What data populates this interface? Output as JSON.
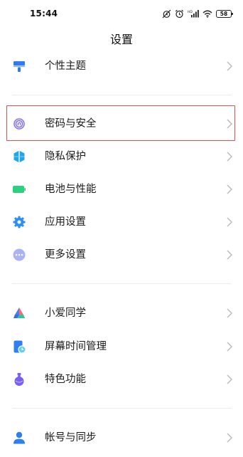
{
  "status_bar": {
    "time": "15:44",
    "battery_level": "58",
    "icons": [
      "alarm-off-icon",
      "alarm-clock-icon",
      "cellular-signal-icon",
      "wifi-icon",
      "battery-icon"
    ]
  },
  "page": {
    "title": "设置"
  },
  "groups": [
    {
      "items": [
        {
          "label": "个性主题",
          "icon": "theme-brush-icon",
          "color": "#2d7cf6"
        }
      ]
    },
    {
      "items": [
        {
          "label": "密码与安全",
          "icon": "fingerprint-icon",
          "color": "#7f6de0",
          "highlighted": true
        },
        {
          "label": "隐私保护",
          "icon": "privacy-shield-icon",
          "color": "#23a6e8"
        },
        {
          "label": "电池与性能",
          "icon": "battery-icon",
          "color": "#2bd17c"
        },
        {
          "label": "应用设置",
          "icon": "gear-icon",
          "color": "#2e8ff2"
        },
        {
          "label": "更多设置",
          "icon": "more-dots-icon",
          "color": "#8f9bf2"
        }
      ]
    },
    {
      "items": [
        {
          "label": "小爱同学",
          "icon": "xiaoai-assistant-icon",
          "color": "#4e7cf4"
        },
        {
          "label": "屏幕时间管理",
          "icon": "screen-time-icon",
          "color": "#2f7ff0"
        },
        {
          "label": "特色功能",
          "icon": "feature-potion-icon",
          "color": "#7a5ef0"
        }
      ]
    },
    {
      "items": [
        {
          "label": "帐号与同步",
          "icon": "account-person-icon",
          "color": "#2f7ff0"
        }
      ]
    }
  ],
  "highlight_color": "#d9534f"
}
